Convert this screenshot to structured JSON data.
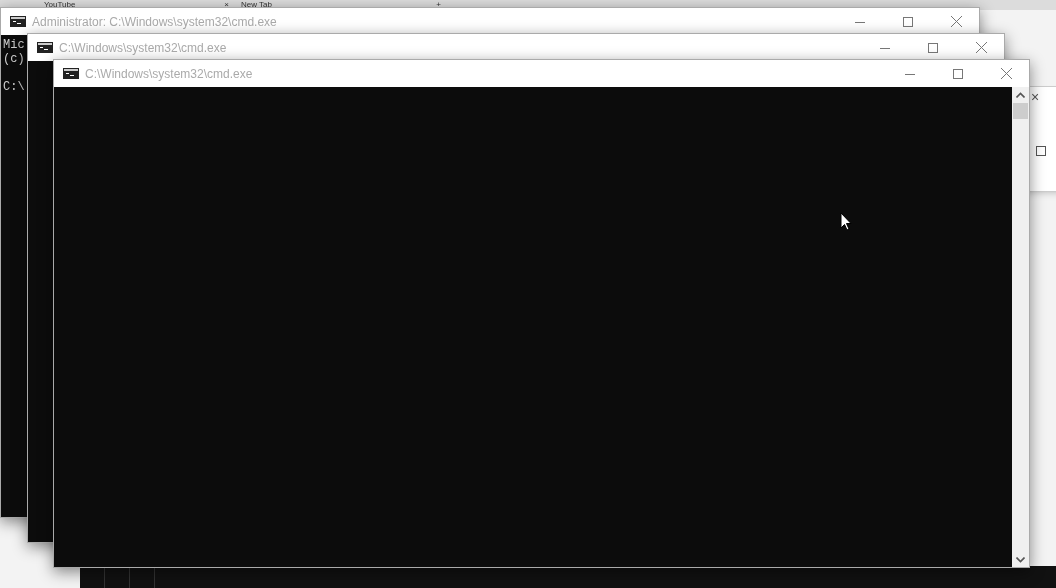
{
  "browser_tabs": [
    {
      "label": "YouTube",
      "close": "×"
    },
    {
      "label": "New Tab",
      "close": "+"
    }
  ],
  "background_window": {
    "close": "×"
  },
  "windows": [
    {
      "title": "Administrator: C:\\Windows\\system32\\cmd.exe",
      "console_lines": [
        {
          "kind": "output",
          "text": "Mic"
        },
        {
          "kind": "output",
          "text": "(c)"
        },
        {
          "kind": "prompt",
          "text": "C:\\"
        }
      ]
    },
    {
      "title": "C:\\Windows\\system32\\cmd.exe"
    },
    {
      "title": "C:\\Windows\\system32\\cmd.exe",
      "scrollbar": true
    }
  ]
}
